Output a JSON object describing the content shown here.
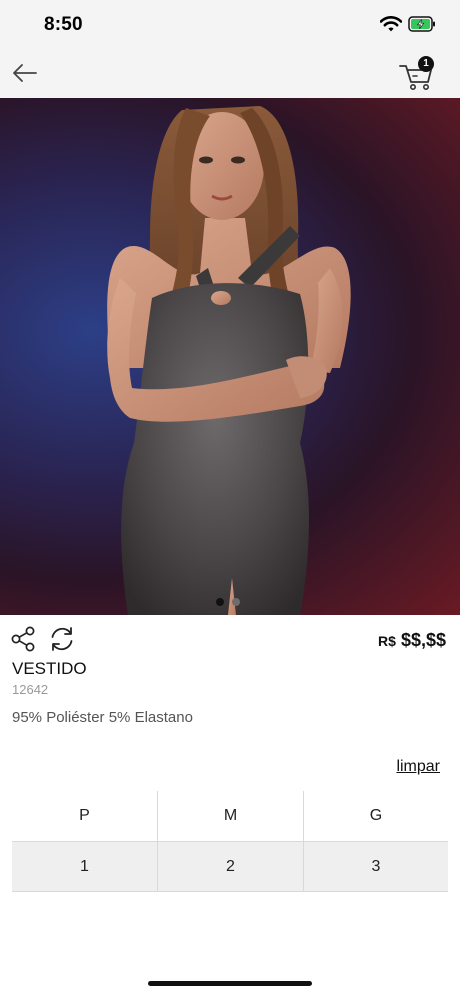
{
  "status_bar": {
    "time": "8:50",
    "wifi_icon": "wifi-icon",
    "battery_icon": "battery-charging-icon",
    "battery_color": "#34c759"
  },
  "nav": {
    "back_icon": "arrow-left-icon",
    "cart_icon": "shopping-cart-icon",
    "cart_count": "1"
  },
  "hero": {
    "image": "photo of model wearing dark glitter halter dress",
    "slides": 2,
    "active_slide": 1
  },
  "product": {
    "share_icon": "share-icon",
    "refresh_icon": "refresh-icon",
    "price_currency": "R$",
    "price_value": "$$,$$",
    "name": "VESTIDO",
    "code": "12642",
    "composition": "95% Poliéster 5% Elastano"
  },
  "sizes": {
    "clear_label": "limpar",
    "columns": [
      "P",
      "M",
      "G"
    ],
    "quantities": [
      "1",
      "2",
      "3"
    ]
  }
}
